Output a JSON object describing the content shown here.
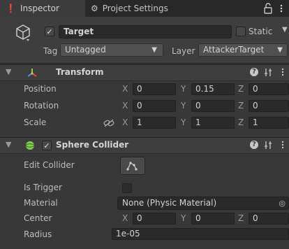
{
  "tabs": {
    "inspector": {
      "label": "Inspector"
    },
    "project_settings": {
      "label": "Project Settings"
    }
  },
  "header": {
    "name_value": "Target",
    "static_label": "Static",
    "tag_label": "Tag",
    "tag_value": "Untagged",
    "layer_label": "Layer",
    "layer_value": "AttackerTarget"
  },
  "transform": {
    "title": "Transform",
    "position": {
      "label": "Position",
      "x": "0",
      "y": "0.15",
      "z": "0"
    },
    "rotation": {
      "label": "Rotation",
      "x": "0",
      "y": "0",
      "z": "0"
    },
    "scale": {
      "label": "Scale",
      "x": "1",
      "y": "1",
      "z": "1"
    }
  },
  "sphere_collider": {
    "title": "Sphere Collider",
    "edit_collider_label": "Edit Collider",
    "is_trigger_label": "Is Trigger",
    "material_label": "Material",
    "material_value": "None (Physic Material)",
    "center": {
      "label": "Center",
      "x": "0",
      "y": "0",
      "z": "0"
    },
    "radius_label": "Radius",
    "radius_value": "1e-05"
  },
  "axis_labels": {
    "x": "X",
    "y": "Y",
    "z": "Z"
  },
  "colors": {
    "background": "#383838",
    "tabbar": "#282828",
    "field": "#2a2a2a",
    "sphere_icon": "#84d04a",
    "accent_red": "#e0493b",
    "accent_green": "#84d04a",
    "accent_blue": "#4a8fe0"
  },
  "icons": [
    "info-icon",
    "gear-icon",
    "lock-icon",
    "menu-dots-icon",
    "cube-icon",
    "transform-axes-icon",
    "help-icon",
    "sliders-icon",
    "sphere-icon",
    "link-icon",
    "edit-collider-icon",
    "object-picker-icon",
    "foldout-arrow-icon"
  ]
}
